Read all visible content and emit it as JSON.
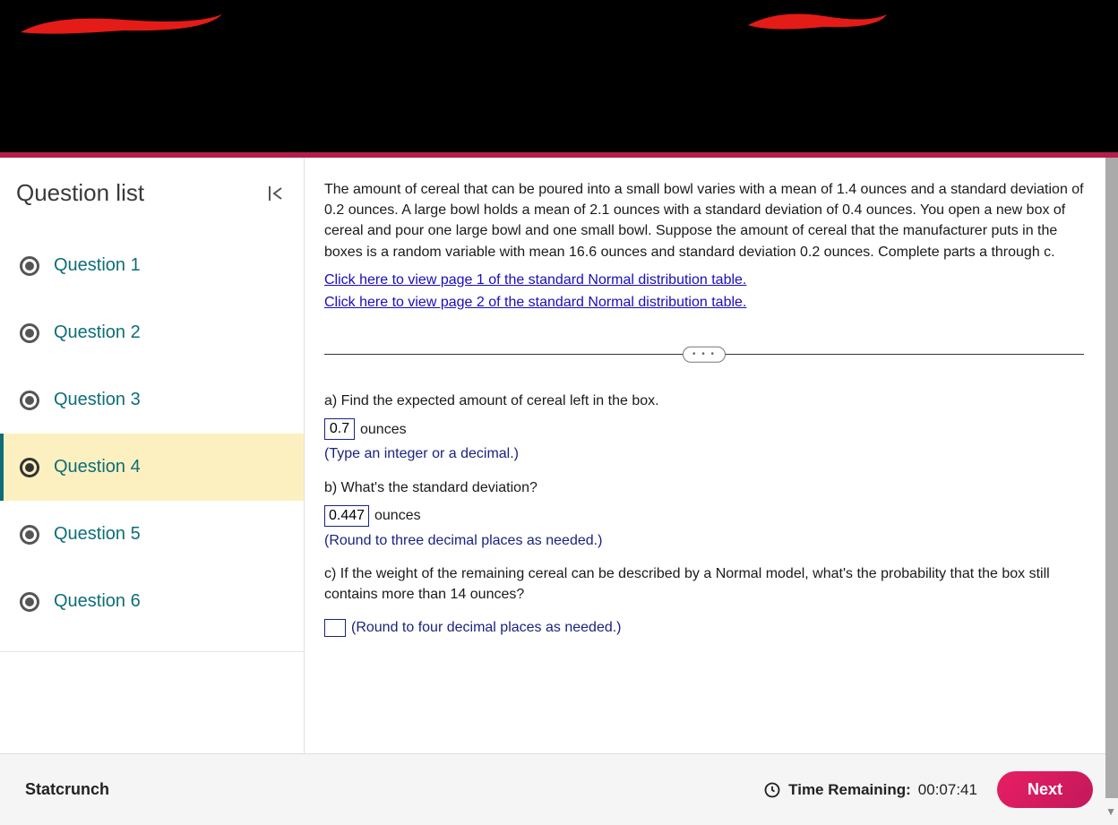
{
  "sidebar": {
    "title": "Question list",
    "items": [
      {
        "label": "Question 1"
      },
      {
        "label": "Question 2"
      },
      {
        "label": "Question 3"
      },
      {
        "label": "Question 4"
      },
      {
        "label": "Question 5"
      },
      {
        "label": "Question 6"
      }
    ],
    "active_index": 3
  },
  "content": {
    "intro": "The amount of cereal that can be poured into a small bowl varies with a mean of 1.4 ounces and a standard deviation of 0.2 ounces. A large bowl holds a mean of 2.1 ounces with a standard deviation of 0.4 ounces. You open a new box of cereal and pour one large bowl and one small bowl. Suppose the amount of cereal that the manufacturer puts in the boxes is a random variable with mean 16.6 ounces and standard deviation 0.2 ounces. Complete parts a through c.",
    "link1": "Click here to view page 1 of the standard Normal distribution table.",
    "link2": "Click here to view page 2 of the standard Normal distribution table.",
    "divider_label": "• • •",
    "part_a": {
      "prompt": "a) Find the expected amount of cereal left in the box.",
      "value": "0.7",
      "unit": "ounces",
      "hint": "(Type an integer or a decimal.)"
    },
    "part_b": {
      "prompt": "b) What's the standard deviation?",
      "value": "0.447",
      "unit": "ounces",
      "hint": "(Round to three decimal places as needed.)"
    },
    "part_c": {
      "prompt": "c) If the weight of the remaining cereal can be described by a Normal model, what's the probability that the box still contains more than 14 ounces?",
      "value": "",
      "hint": "(Round to four decimal places as needed.)"
    }
  },
  "footer": {
    "tool": "Statcrunch",
    "time_label": "Time Remaining:",
    "time_value": "00:07:41",
    "next": "Next"
  }
}
